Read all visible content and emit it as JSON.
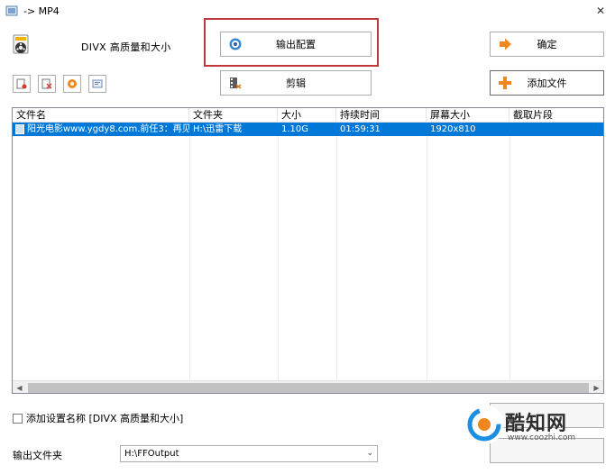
{
  "window": {
    "title": "-> MP4",
    "close_glyph": "✕"
  },
  "profile": {
    "label": "DIVX 高质量和大小",
    "icon": "film-reel-icon"
  },
  "buttons": {
    "output_config": "输出配置",
    "edit": "剪辑",
    "ok": "确定",
    "add_file": "添加文件"
  },
  "list": {
    "columns": [
      "文件名",
      "文件夹",
      "大小",
      "持续时间",
      "屏幕大小",
      "截取片段"
    ],
    "rows": [
      {
        "name": "阳光电影www.ygdy8.com.前任3：再见...",
        "folder": "H:\\迅雷下载",
        "size": "1.10G",
        "duration": "01:59:31",
        "resolution": "1920x810",
        "clip": ""
      }
    ]
  },
  "options": {
    "add_name_label": "添加设置名称 [DIVX 高质量和大小]"
  },
  "output": {
    "label": "输出文件夹",
    "folder": "H:\\FFOutput"
  },
  "watermark": {
    "brand": "酷知网",
    "url": "www.coozhi.com"
  },
  "colors": {
    "highlight": "#c0383a",
    "selection": "#0078d7",
    "accent_orange": "#f0871e"
  }
}
